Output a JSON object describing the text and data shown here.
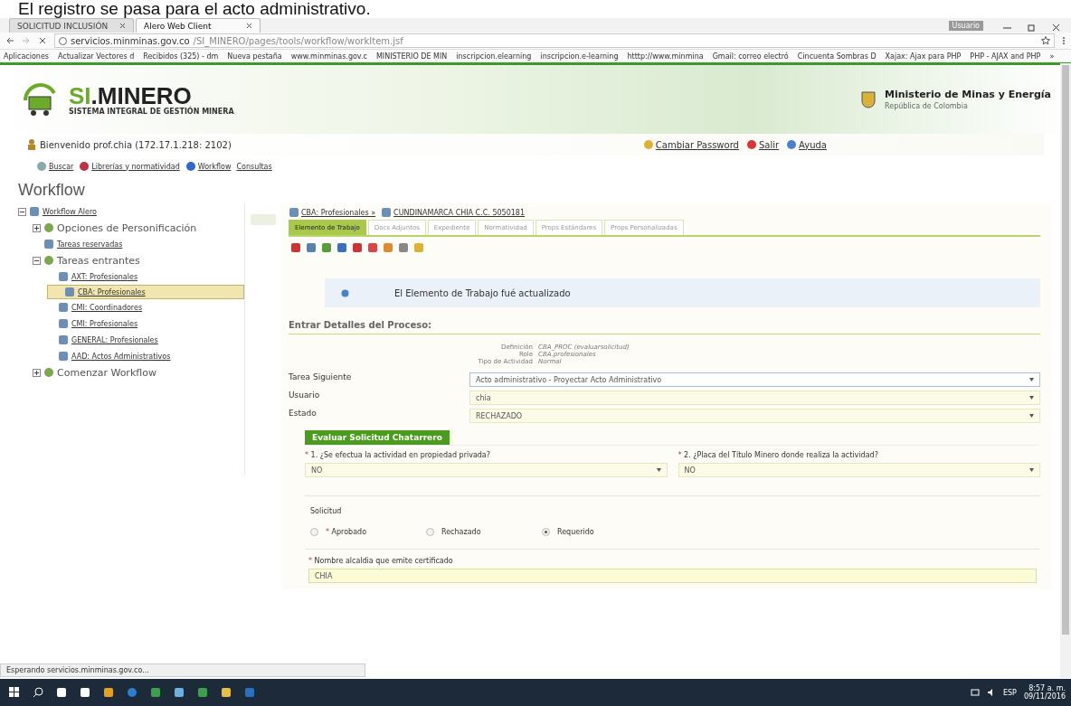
{
  "caption": "El registro se pasa para el acto administrativo.",
  "browser": {
    "tabs": [
      {
        "label": "SOLICITUD INCLUSIÓN",
        "selected": false
      },
      {
        "label": "Alero Web Client",
        "selected": true
      }
    ],
    "profile": "Usuario",
    "url_host": "servicios.minminas.gov.co",
    "url_path": "/SI_MINERO/pages/tools/workflow/workItem.jsf",
    "bookmarks": [
      "Aplicaciones",
      "Actualizar Vectores d",
      "Recibidos (325) - dm",
      "Nueva pestaña",
      "www.minminas.gov.c",
      "MINISTERIO DE MIN",
      "inscripcion.elearning",
      "inscripcion.e-learning",
      "htttp://www.minmina",
      "Gmail: correo electró",
      "Cincuenta Sombras D",
      "Xajax: Ajax para PHP",
      "PHP - AJAX and PHP"
    ],
    "more": "»"
  },
  "header": {
    "logo_prefix": "SI",
    "logo_suffix": ".MINERO",
    "logo_tagline": "SISTEMA INTEGRAL DE GESTIÓN MINERA",
    "ministry": "Ministerio de Minas y Energía",
    "country": "República de Colombia",
    "welcome": "Bienvenido prof.chia (172.17.1.218: 2102)",
    "user_links": [
      "Cambiar Password",
      "Salir",
      "Ayuda"
    ],
    "nav": [
      "Buscar",
      "Librerías y normatividad",
      "Workflow",
      "Consultas"
    ]
  },
  "page_title": "Workflow",
  "tree": [
    {
      "label": "Workflow Alero",
      "kind": "link",
      "expanded": true,
      "children": [
        {
          "label": "Opciones de Personificación",
          "kind": "group",
          "expanded": false,
          "selected": false
        },
        {
          "label": "Tareas reservadas",
          "kind": "link",
          "selected": false
        },
        {
          "label": "Tareas entrantes",
          "kind": "group",
          "expanded": true,
          "selected": false,
          "children": [
            {
              "label": "AXT: Profesionales",
              "kind": "link",
              "selected": false
            },
            {
              "label": "CBA: Profesionales",
              "kind": "link",
              "selected": true
            },
            {
              "label": "CMI: Coordinadores",
              "kind": "link",
              "selected": false
            },
            {
              "label": "CMI: Profesionales",
              "kind": "link",
              "selected": false
            },
            {
              "label": "GENERAL: Profesionales",
              "kind": "link",
              "selected": false
            },
            {
              "label": "AAD: Actos Administrativos",
              "kind": "link",
              "selected": false
            }
          ]
        },
        {
          "label": "Comenzar Workflow",
          "kind": "group",
          "expanded": false,
          "selected": false
        }
      ]
    }
  ],
  "breadcrumb": [
    "CBA: Profesionales »",
    "CUNDINAMARCA CHIA C.C. 5050181"
  ],
  "tabs": [
    {
      "label": "Elemento de Trabajo",
      "selected": true
    },
    {
      "label": "Docs Adjuntos",
      "selected": false
    },
    {
      "label": "Expediente",
      "selected": false
    },
    {
      "label": "Normatividad",
      "selected": false
    },
    {
      "label": "Props Estándares",
      "selected": false
    },
    {
      "label": "Props Personalizadas",
      "selected": false
    }
  ],
  "message": "El Elemento de Trabajo fué actualizado",
  "details_title": "Entrar Detalles del Proceso:",
  "details": [
    {
      "label": "Definición",
      "value": "CBA_PROC (evaluarsolicitud)"
    },
    {
      "label": "Role",
      "value": "CBA.profesionales"
    },
    {
      "label": "Tipo de Actividad",
      "value": "Normal"
    }
  ],
  "selects": [
    {
      "label": "Tarea Siguiente",
      "value": "Acto administrativo - Proyectar Acto Administrativo",
      "focused": true
    },
    {
      "label": "Usuario",
      "value": "chia",
      "focused": false
    },
    {
      "label": "Estado",
      "value": "RECHAZADO",
      "focused": false
    }
  ],
  "form": {
    "title": "Evaluar Solicitud Chatarrero",
    "questions": [
      {
        "mark": "*",
        "label": "1. ¿Se efectua la actividad en propiedad privada?",
        "value": "NO"
      },
      {
        "mark": "*",
        "label": "2. ¿Placa del Título Minero donde realiza la actividad?",
        "value": "NO"
      }
    ],
    "radio_label": "Solicitud",
    "options": [
      {
        "mark": "*",
        "label": "Aprobado",
        "selected": false
      },
      {
        "label": "Rechazado",
        "selected": false
      },
      {
        "label": "Requerido",
        "selected": true
      }
    ],
    "text_field": {
      "mark": "*",
      "label": "Nombre alcaldia que emite certificado",
      "value": "CHIA"
    }
  },
  "status": "Esperando servicios.minminas.gov.co...",
  "taskbar": {
    "language": "ESP",
    "time": "8:57 a. m.",
    "date": "09/11/2016"
  }
}
